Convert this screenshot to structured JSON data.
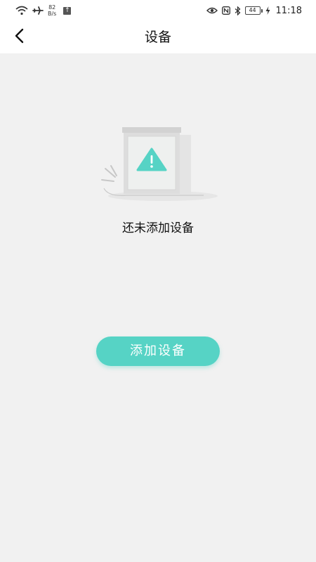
{
  "status_bar": {
    "net_speed_value": "82",
    "net_speed_unit": "B/s",
    "upload_glyph": "↑",
    "battery_level": "44",
    "time": "11:18",
    "icons": [
      "wifi-icon",
      "airplane-icon",
      "upload-icon",
      "eye-icon",
      "nfc-icon",
      "bluetooth-icon",
      "battery-icon",
      "charging-icon"
    ]
  },
  "header": {
    "title": "设备",
    "back_icon": "chevron-left-icon"
  },
  "empty_state": {
    "illustration": "empty-device-box-illustration",
    "warning_icon": "warning-triangle-icon",
    "message": "还未添加设备"
  },
  "actions": {
    "add_device_label": "添加设备"
  },
  "colors": {
    "accent": "#56d3c5",
    "background": "#f1f1f1",
    "header_background": "#ffffff"
  }
}
